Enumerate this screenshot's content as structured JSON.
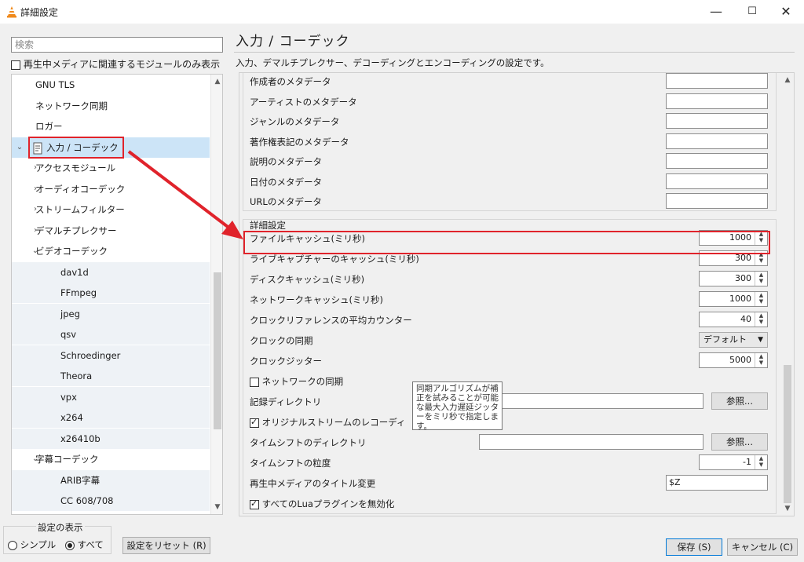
{
  "window": {
    "title": "詳細設定",
    "minimize_icon": "—",
    "maximize_icon": "☐",
    "close_icon": "✕"
  },
  "sidebar": {
    "search_placeholder": "検索",
    "filter_checkbox_label": "再生中メディアに関連するモジュールのみ表示",
    "filter_checked": false,
    "tree": [
      {
        "label": "GNU TLS",
        "level": 1,
        "arrow": "",
        "selected": false
      },
      {
        "label": "ネットワーク同期",
        "level": 1,
        "arrow": "",
        "selected": false
      },
      {
        "label": "ロガー",
        "level": 1,
        "arrow": "",
        "selected": false
      },
      {
        "label": "入力 / コーデック",
        "level": 0,
        "arrow": "∨",
        "selected": true,
        "icon": "codec-icon"
      },
      {
        "label": "アクセスモジュール",
        "level": 1,
        "arrow": "›",
        "selected": false
      },
      {
        "label": "オーディオコーデック",
        "level": 1,
        "arrow": "›",
        "selected": false
      },
      {
        "label": "ストリームフィルター",
        "level": 1,
        "arrow": "›",
        "selected": false
      },
      {
        "label": "デマルチプレクサー",
        "level": 1,
        "arrow": "›",
        "selected": false
      },
      {
        "label": "ビデオコーデック",
        "level": 1,
        "arrow": "∨",
        "selected": false
      },
      {
        "label": "dav1d",
        "level": 2,
        "arrow": "",
        "selected": false
      },
      {
        "label": "FFmpeg",
        "level": 2,
        "arrow": "",
        "selected": false
      },
      {
        "label": "jpeg",
        "level": 2,
        "arrow": "",
        "selected": false
      },
      {
        "label": "qsv",
        "level": 2,
        "arrow": "",
        "selected": false
      },
      {
        "label": "Schroedinger",
        "level": 2,
        "arrow": "",
        "selected": false
      },
      {
        "label": "Theora",
        "level": 2,
        "arrow": "",
        "selected": false
      },
      {
        "label": "vpx",
        "level": 2,
        "arrow": "",
        "selected": false
      },
      {
        "label": "x264",
        "level": 2,
        "arrow": "",
        "selected": false
      },
      {
        "label": "x26410b",
        "level": 2,
        "arrow": "",
        "selected": false
      },
      {
        "label": "字幕コーデック",
        "level": 1,
        "arrow": "∨",
        "selected": false
      },
      {
        "label": "ARIB字幕",
        "level": 2,
        "arrow": "",
        "selected": false
      },
      {
        "label": "CC 608/708",
        "level": 2,
        "arrow": "",
        "selected": false
      }
    ],
    "scroll_position": 0.62
  },
  "main": {
    "heading": "入力 / コーデック",
    "description": "入力、デマルチプレクサー、デコーディングとエンコーディングの設定です。",
    "metadata_rows": [
      {
        "label": "作成者のメタデータ",
        "value": ""
      },
      {
        "label": "アーティストのメタデータ",
        "value": ""
      },
      {
        "label": "ジャンルのメタデータ",
        "value": ""
      },
      {
        "label": "著作権表記のメタデータ",
        "value": ""
      },
      {
        "label": "説明のメタデータ",
        "value": ""
      },
      {
        "label": "日付のメタデータ",
        "value": ""
      },
      {
        "label": "URLのメタデータ",
        "value": ""
      }
    ],
    "advanced": {
      "group_title": "詳細設定",
      "file_cache": {
        "label": "ファイルキャッシュ(ミリ秒)",
        "value": "1000"
      },
      "live_cache": {
        "label": "ライブキャプチャーのキャッシュ(ミリ秒)",
        "value": "300"
      },
      "disc_cache": {
        "label": "ディスクキャッシュ(ミリ秒)",
        "value": "300"
      },
      "network_cache": {
        "label": "ネットワークキャッシュ(ミリ秒)",
        "value": "1000"
      },
      "clock_ref_avg": {
        "label": "クロックリファレンスの平均カウンター",
        "value": "40"
      },
      "clock_sync": {
        "label": "クロックの同期",
        "value": "デフォルト"
      },
      "clock_jitter": {
        "label": "クロックジッター",
        "value": "5000"
      },
      "network_sync": {
        "label": "ネットワークの同期",
        "checked": false
      },
      "record_dir": {
        "label": "記録ディレクトリ",
        "value": "",
        "browse": "参照..."
      },
      "record_original": {
        "label": "オリジナルストリームのレコーディ",
        "checked": true
      },
      "timeshift_dir": {
        "label": "タイムシフトのディレクトリ",
        "value": "",
        "browse": "参照..."
      },
      "timeshift_granularity": {
        "label": "タイムシフトの粒度",
        "value": "-1"
      },
      "title_change": {
        "label": "再生中メディアのタイトル変更",
        "value": "$Z"
      },
      "disable_lua": {
        "label": "すべてのLuaプラグインを無効化",
        "checked": true
      }
    },
    "tooltip": "同期アルゴリズムが補正を試みることが可能な最大入力遅延ジッターをミリ秒で指定します。",
    "scroll_position": 0.88
  },
  "footer": {
    "display_group_title": "設定の表示",
    "radio_simple": "シンプル",
    "radio_all": "すべて",
    "selected_mode": "all",
    "reset_button": "設定をリセット (R)",
    "save_button": "保存 (S)",
    "cancel_button": "キャンセル (C)"
  },
  "colors": {
    "annotation_red": "#e0232b",
    "selection_blue": "#cce4f7",
    "accent_border": "#0078d7"
  }
}
